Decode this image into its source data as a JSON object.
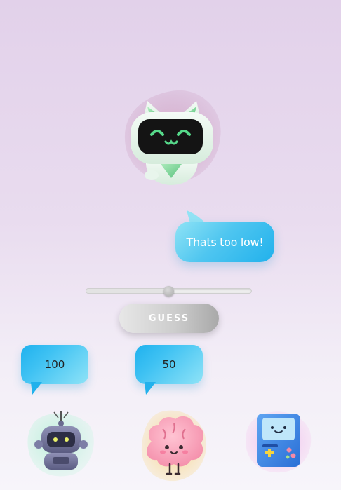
{
  "reply": {
    "text": "Thats too low!"
  },
  "slider": {
    "value": 50,
    "min": 0,
    "max": 100
  },
  "guess_button": {
    "label": "GUESS"
  },
  "bubbles": {
    "high": "100",
    "current": "50"
  },
  "characters": {
    "main": "cat-robot-icon",
    "left": "robot-icon",
    "center": "brain-icon",
    "right": "game-console-icon"
  },
  "colors": {
    "bubble_blue": "#21b1ec",
    "button_gray": "#b3b3b3",
    "background": "#e2d1ea"
  }
}
